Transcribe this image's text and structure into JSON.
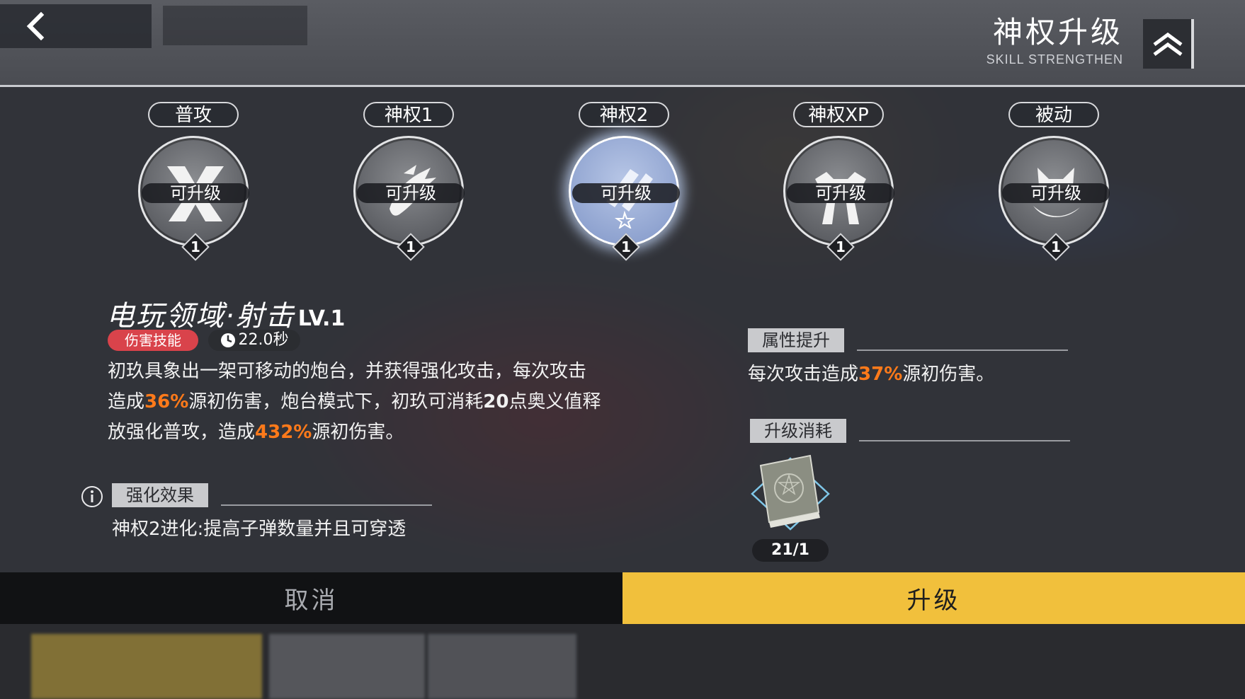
{
  "header": {
    "title": "神权升级",
    "subtitle": "SKILL STRENGTHEN",
    "back_icon": "chevron-left-icon",
    "title_icon": "double-chevron-up-icon"
  },
  "skills": [
    {
      "tab": "普攻",
      "status": "可升级",
      "level": "1",
      "icon": "x-cross-icon",
      "active": false
    },
    {
      "tab": "神权1",
      "status": "可升级",
      "level": "1",
      "icon": "dragon-cannon-icon",
      "active": false
    },
    {
      "tab": "神权2",
      "status": "可升级",
      "level": "1",
      "icon": "turret-rockets-icon",
      "active": true
    },
    {
      "tab": "神权XP",
      "status": "可升级",
      "level": "1",
      "icon": "mech-robot-icon",
      "active": false
    },
    {
      "tab": "被动",
      "status": "可升级",
      "level": "1",
      "icon": "fox-icon",
      "active": false
    }
  ],
  "detail": {
    "name": "电玩领域·射击",
    "level": "LV.1",
    "type_tag": "伤害技能",
    "cooldown": "22.0秒",
    "desc": {
      "l1": "初玖具象出一架可移动的炮台，并获得强化攻击，每次攻击",
      "l2a": "造成",
      "l2b": "36%",
      "l2c": "源初伤害，炮台模式下，初玖可消耗",
      "l2d": "20",
      "l2e": "点奥义值释",
      "l3a": "放强化普攻，造成",
      "l3b": "432%",
      "l3c": "源初伤害。"
    },
    "effect_title": "强化效果",
    "effect_text": "神权2进化:提高子弹数量并且可穿透"
  },
  "attributes": {
    "title": "属性提升",
    "text_a": "每次攻击造成",
    "text_b": "37%",
    "text_c": "源初伤害。"
  },
  "cost": {
    "title": "升级消耗",
    "item_icon": "skill-book-icon",
    "count": "21/1"
  },
  "buttons": {
    "cancel": "取消",
    "upgrade": "升级"
  },
  "colors": {
    "accent_yellow": "#f1c03c",
    "highlight_orange": "#ff7a1a",
    "damage_tag_red": "#d9434b"
  }
}
